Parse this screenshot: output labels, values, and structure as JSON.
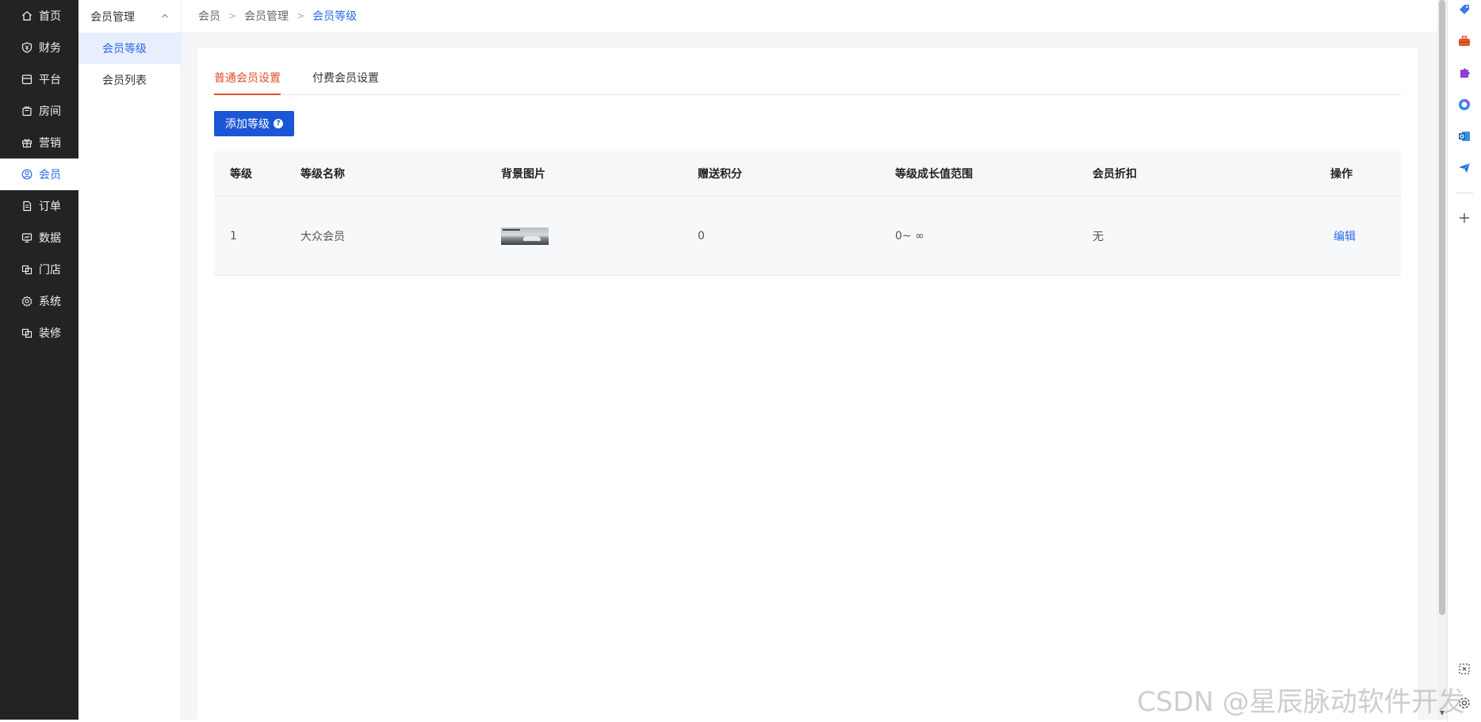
{
  "nav": {
    "items": [
      {
        "label": "首页",
        "icon": "home-icon"
      },
      {
        "label": "财务",
        "icon": "yen-shield-icon"
      },
      {
        "label": "平台",
        "icon": "store-icon"
      },
      {
        "label": "房间",
        "icon": "bag-icon"
      },
      {
        "label": "营销",
        "icon": "gift-icon"
      },
      {
        "label": "会员",
        "icon": "user-circle-icon"
      },
      {
        "label": "订单",
        "icon": "document-icon"
      },
      {
        "label": "数据",
        "icon": "monitor-icon"
      },
      {
        "label": "门店",
        "icon": "shop-icon"
      },
      {
        "label": "系统",
        "icon": "gear-icon"
      },
      {
        "label": "装修",
        "icon": "brush-icon"
      }
    ],
    "active_index": 5
  },
  "subnav": {
    "title": "会员管理",
    "items": [
      {
        "label": "会员等级"
      },
      {
        "label": "会员列表"
      }
    ]
  },
  "breadcrumb": {
    "items": [
      "会员",
      "会员管理",
      "会员等级"
    ]
  },
  "tabs": [
    {
      "label": "普通会员设置"
    },
    {
      "label": "付费会员设置"
    }
  ],
  "add_button": {
    "label": "添加等级",
    "hint": "?"
  },
  "table": {
    "headers": [
      "等级",
      "等级名称",
      "背景图片",
      "赠送积分",
      "等级成长值范围",
      "会员折扣",
      "操作"
    ],
    "rows": [
      {
        "level": "1",
        "name": "大众会员",
        "points": "0",
        "range": "0~ ∞",
        "discount": "无",
        "action": "编辑"
      }
    ]
  },
  "watermark": "CSDN @星辰脉动软件开发",
  "colors": {
    "accent": "#1b56d6",
    "link": "#2a6ae8",
    "tab_active": "#e0502b",
    "sidebar": "#232323"
  },
  "edge_panel": {
    "icons": [
      "tag-icon",
      "toolbox-icon",
      "puzzle-icon",
      "copilot-icon",
      "outlook-icon",
      "send-icon",
      "plus-icon",
      "screenshot-icon",
      "settings-icon"
    ]
  }
}
